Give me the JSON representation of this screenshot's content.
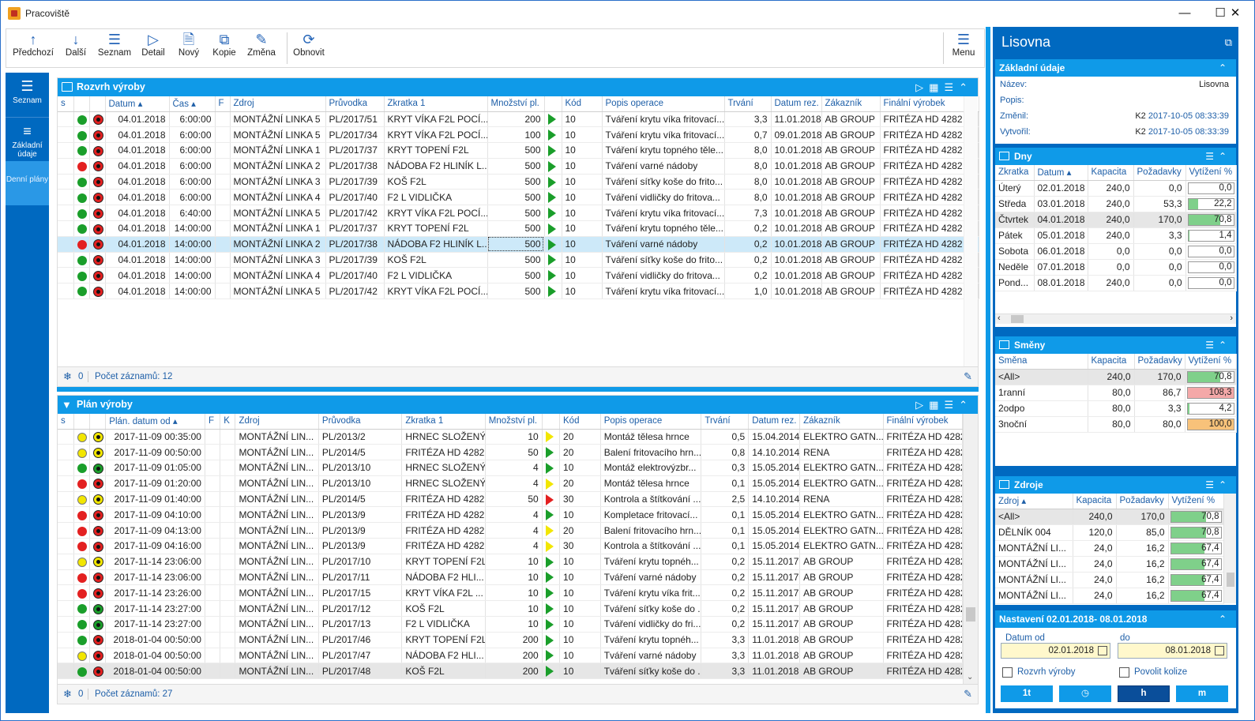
{
  "window": {
    "title": "Pracoviště"
  },
  "toolbar": {
    "prev": "Předchozí",
    "next": "Další",
    "list": "Seznam",
    "detail": "Detail",
    "new": "Nový",
    "copy": "Kopie",
    "change": "Změna",
    "refresh": "Obnovit",
    "menu": "Menu"
  },
  "nav": {
    "list": "Seznam",
    "basic": "Základní údaje",
    "daily": "Denní plány"
  },
  "schedule": {
    "title": "Rozvrh výroby",
    "columns": [
      "s",
      "",
      "",
      "Datum",
      "Čas",
      "F",
      "Zdroj",
      "Průvodka",
      "Zkratka 1",
      "Množství pl.",
      "",
      "Kód",
      "Popis operace",
      "Trvání",
      "Datum rez.",
      "Zákazník",
      "Finální výrobek"
    ],
    "rows": [
      {
        "st": "g",
        "star": "r",
        "date": "04.01.2018",
        "time": "6:00:00",
        "src": "MONTÁŽNÍ LINKA 5",
        "doc": "PL/2017/51",
        "abbr": "KRYT VÍKA F2L POCÍ...",
        "qty": "200",
        "tri": "g",
        "code": "10",
        "op": "Tváření krytu víka fritovací...",
        "dur": "3,3",
        "rez": "11.01.2018",
        "cust": "AB GROUP",
        "prod": "FRITÉZA HD 4282",
        "flag": true
      },
      {
        "st": "g",
        "star": "r",
        "date": "04.01.2018",
        "time": "6:00:00",
        "src": "MONTÁŽNÍ LINKA 5",
        "doc": "PL/2017/34",
        "abbr": "KRYT VÍKA F2L POCÍ...",
        "qty": "100",
        "tri": "g",
        "code": "10",
        "op": "Tváření krytu víka fritovací...",
        "dur": "0,7",
        "rez": "09.01.2018",
        "cust": "AB GROUP",
        "prod": "FRITÉZA HD 4282",
        "flag": true
      },
      {
        "st": "g",
        "star": "r",
        "date": "04.01.2018",
        "time": "6:00:00",
        "src": "MONTÁŽNÍ LINKA 1",
        "doc": "PL/2017/37",
        "abbr": "KRYT TOPENÍ F2L",
        "qty": "500",
        "tri": "g",
        "code": "10",
        "op": "Tváření krytu topného těle...",
        "dur": "8,0",
        "rez": "10.01.2018",
        "cust": "AB GROUP",
        "prod": "FRITÉZA HD 4282",
        "flag": false
      },
      {
        "st": "r",
        "star": "r",
        "date": "04.01.2018",
        "time": "6:00:00",
        "src": "MONTÁŽNÍ LINKA 2",
        "doc": "PL/2017/38",
        "abbr": "NÁDOBA F2 HLINÍK L...",
        "qty": "500",
        "tri": "g",
        "code": "10",
        "op": "Tváření varné nádoby",
        "dur": "8,0",
        "rez": "10.01.2018",
        "cust": "AB GROUP",
        "prod": "FRITÉZA HD 4282",
        "flag": false
      },
      {
        "st": "g",
        "star": "r",
        "date": "04.01.2018",
        "time": "6:00:00",
        "src": "MONTÁŽNÍ LINKA 3",
        "doc": "PL/2017/39",
        "abbr": "KOŠ F2L",
        "qty": "500",
        "tri": "g",
        "code": "10",
        "op": "Tváření síťky koše do frito...",
        "dur": "8,0",
        "rez": "10.01.2018",
        "cust": "AB GROUP",
        "prod": "FRITÉZA HD 4282",
        "flag": false
      },
      {
        "st": "g",
        "star": "r",
        "date": "04.01.2018",
        "time": "6:00:00",
        "src": "MONTÁŽNÍ LINKA 4",
        "doc": "PL/2017/40",
        "abbr": "F2 L VIDLIČKA",
        "qty": "500",
        "tri": "g",
        "code": "10",
        "op": "Tváření vidličky do fritova...",
        "dur": "8,0",
        "rez": "10.01.2018",
        "cust": "AB GROUP",
        "prod": "FRITÉZA HD 4282",
        "flag": false
      },
      {
        "st": "g",
        "star": "r",
        "date": "04.01.2018",
        "time": "6:40:00",
        "src": "MONTÁŽNÍ LINKA 5",
        "doc": "PL/2017/42",
        "abbr": "KRYT VÍKA F2L POCÍ...",
        "qty": "500",
        "tri": "g",
        "code": "10",
        "op": "Tváření krytu víka fritovací...",
        "dur": "7,3",
        "rez": "10.01.2018",
        "cust": "AB GROUP",
        "prod": "FRITÉZA HD 4282",
        "flag": true
      },
      {
        "st": "g",
        "star": "r",
        "date": "04.01.2018",
        "time": "14:00:00",
        "src": "MONTÁŽNÍ LINKA 1",
        "doc": "PL/2017/37",
        "abbr": "KRYT TOPENÍ F2L",
        "qty": "500",
        "tri": "g",
        "code": "10",
        "op": "Tváření krytu topného těle...",
        "dur": "0,2",
        "rez": "10.01.2018",
        "cust": "AB GROUP",
        "prod": "FRITÉZA HD 4282",
        "flag": false
      },
      {
        "st": "r",
        "star": "r",
        "date": "04.01.2018",
        "time": "14:00:00",
        "src": "MONTÁŽNÍ LINKA 2",
        "doc": "PL/2017/38",
        "abbr": "NÁDOBA F2 HLINÍK L...",
        "qty": "500",
        "tri": "g",
        "code": "10",
        "op": "Tváření varné nádoby",
        "dur": "0,2",
        "rez": "10.01.2018",
        "cust": "AB GROUP",
        "prod": "FRITÉZA HD 4282",
        "flag": false,
        "sel": true
      },
      {
        "st": "g",
        "star": "r",
        "date": "04.01.2018",
        "time": "14:00:00",
        "src": "MONTÁŽNÍ LINKA 3",
        "doc": "PL/2017/39",
        "abbr": "KOŠ F2L",
        "qty": "500",
        "tri": "g",
        "code": "10",
        "op": "Tváření síťky koše do frito...",
        "dur": "0,2",
        "rez": "10.01.2018",
        "cust": "AB GROUP",
        "prod": "FRITÉZA HD 4282",
        "flag": false
      },
      {
        "st": "g",
        "star": "r",
        "date": "04.01.2018",
        "time": "14:00:00",
        "src": "MONTÁŽNÍ LINKA 4",
        "doc": "PL/2017/40",
        "abbr": "F2 L VIDLIČKA",
        "qty": "500",
        "tri": "g",
        "code": "10",
        "op": "Tváření vidličky do fritova...",
        "dur": "0,2",
        "rez": "10.01.2018",
        "cust": "AB GROUP",
        "prod": "FRITÉZA HD 4282",
        "flag": false
      },
      {
        "st": "g",
        "star": "r",
        "date": "04.01.2018",
        "time": "14:00:00",
        "src": "MONTÁŽNÍ LINKA 5",
        "doc": "PL/2017/42",
        "abbr": "KRYT VÍKA F2L POCÍ...",
        "qty": "500",
        "tri": "g",
        "code": "10",
        "op": "Tváření krytu víka fritovací...",
        "dur": "1,0",
        "rez": "10.01.2018",
        "cust": "AB GROUP",
        "prod": "FRITÉZA HD 4282",
        "flag": true
      }
    ],
    "footer": {
      "count0": "0",
      "records": "Počet záznamů: 12"
    }
  },
  "plan": {
    "title": "Plán výroby",
    "columns": [
      "s",
      "",
      "",
      "Plán. datum od",
      "F",
      "K",
      "Zdroj",
      "Průvodka",
      "Zkratka 1",
      "Množství pl.",
      "",
      "Kód",
      "Popis operace",
      "Trvání",
      "Datum rez.",
      "Zákazník",
      "Finální výrobek"
    ],
    "rows": [
      {
        "st": "y",
        "star": "y",
        "date": "2017-11-09 00:35:00",
        "src": "MONTÁŽNÍ LIN...",
        "doc": "PL/2013/2",
        "abbr": "HRNEC SLOŽENÝ",
        "qty": "10",
        "tri": "y",
        "code": "20",
        "op": "Montáž tělesa hrnce",
        "dur": "0,5",
        "rez": "15.04.2014",
        "cust": "ELEKTRO GATN...",
        "prod": "FRITÉZA HD 4282"
      },
      {
        "st": "y",
        "star": "y",
        "date": "2017-11-09 00:50:00",
        "src": "MONTÁŽNÍ LIN...",
        "doc": "PL/2014/5",
        "abbr": "FRITÉZA HD 4282",
        "qty": "50",
        "tri": "g",
        "code": "20",
        "op": "Balení fritovacího hrn...",
        "dur": "0,8",
        "rez": "14.10.2014",
        "cust": "RENA",
        "prod": "FRITÉZA HD 4282"
      },
      {
        "st": "g",
        "star": "g",
        "date": "2017-11-09 01:05:00",
        "src": "MONTÁŽNÍ LIN...",
        "doc": "PL/2013/10",
        "abbr": "HRNEC SLOŽENÝ",
        "qty": "4",
        "tri": "g",
        "code": "10",
        "op": "Montáž elektrovýzbr...",
        "dur": "0,3",
        "rez": "15.05.2014",
        "cust": "ELEKTRO GATN...",
        "prod": "FRITÉZA HD 4282"
      },
      {
        "st": "r",
        "star": "r",
        "date": "2017-11-09 01:20:00",
        "src": "MONTÁŽNÍ LIN...",
        "doc": "PL/2013/10",
        "abbr": "HRNEC SLOŽENÝ",
        "qty": "4",
        "tri": "y",
        "code": "20",
        "op": "Montáž tělesa hrnce",
        "dur": "0,1",
        "rez": "15.05.2014",
        "cust": "ELEKTRO GATN...",
        "prod": "FRITÉZA HD 4282"
      },
      {
        "st": "y",
        "star": "y",
        "date": "2017-11-09 01:40:00",
        "src": "MONTÁŽNÍ LIN...",
        "doc": "PL/2014/5",
        "abbr": "FRITÉZA HD 4282",
        "qty": "50",
        "tri": "r",
        "code": "30",
        "op": "Kontrola a štítkování ...",
        "dur": "2,5",
        "rez": "14.10.2014",
        "cust": "RENA",
        "prod": "FRITÉZA HD 4282"
      },
      {
        "st": "r",
        "star": "r",
        "date": "2017-11-09 04:10:00",
        "src": "MONTÁŽNÍ LIN...",
        "doc": "PL/2013/9",
        "abbr": "FRITÉZA HD 4282",
        "qty": "4",
        "tri": "g",
        "code": "10",
        "op": "Kompletace fritovací...",
        "dur": "0,1",
        "rez": "15.05.2014",
        "cust": "ELEKTRO GATN...",
        "prod": "FRITÉZA HD 4282"
      },
      {
        "st": "r",
        "star": "r",
        "date": "2017-11-09 04:13:00",
        "src": "MONTÁŽNÍ LIN...",
        "doc": "PL/2013/9",
        "abbr": "FRITÉZA HD 4282",
        "qty": "4",
        "tri": "y",
        "code": "20",
        "op": "Balení fritovacího hrn...",
        "dur": "0,1",
        "rez": "15.05.2014",
        "cust": "ELEKTRO GATN...",
        "prod": "FRITÉZA HD 4282"
      },
      {
        "st": "r",
        "star": "r",
        "date": "2017-11-09 04:16:00",
        "src": "MONTÁŽNÍ LIN...",
        "doc": "PL/2013/9",
        "abbr": "FRITÉZA HD 4282",
        "qty": "4",
        "tri": "y",
        "code": "30",
        "op": "Kontrola a štítkování ...",
        "dur": "0,1",
        "rez": "15.05.2014",
        "cust": "ELEKTRO GATN...",
        "prod": "FRITÉZA HD 4282"
      },
      {
        "st": "y",
        "star": "y",
        "date": "2017-11-14 23:06:00",
        "src": "MONTÁŽNÍ LIN...",
        "doc": "PL/2017/10",
        "abbr": "KRYT TOPENÍ F2L",
        "qty": "10",
        "tri": "g",
        "code": "10",
        "op": "Tváření krytu topnéh...",
        "dur": "0,2",
        "rez": "15.11.2017",
        "cust": "AB GROUP",
        "prod": "FRITÉZA HD 4282"
      },
      {
        "st": "r",
        "star": "r",
        "date": "2017-11-14 23:06:00",
        "src": "MONTÁŽNÍ LIN...",
        "doc": "PL/2017/11",
        "abbr": "NÁDOBA F2 HLI...",
        "qty": "10",
        "tri": "g",
        "code": "10",
        "op": "Tváření varné nádoby",
        "dur": "0,2",
        "rez": "15.11.2017",
        "cust": "AB GROUP",
        "prod": "FRITÉZA HD 4282"
      },
      {
        "st": "r",
        "star": "r",
        "date": "2017-11-14 23:26:00",
        "src": "MONTÁŽNÍ LIN...",
        "doc": "PL/2017/15",
        "abbr": "KRYT VÍKA F2L ...",
        "qty": "10",
        "tri": "g",
        "code": "10",
        "op": "Tváření krytu víka frit...",
        "dur": "0,2",
        "rez": "15.11.2017",
        "cust": "AB GROUP",
        "prod": "FRITÉZA HD 4282"
      },
      {
        "st": "g",
        "star": "g",
        "date": "2017-11-14 23:27:00",
        "src": "MONTÁŽNÍ LIN...",
        "doc": "PL/2017/12",
        "abbr": "KOŠ F2L",
        "qty": "10",
        "tri": "g",
        "code": "10",
        "op": "Tváření síťky koše do ...",
        "dur": "0,2",
        "rez": "15.11.2017",
        "cust": "AB GROUP",
        "prod": "FRITÉZA HD 4282"
      },
      {
        "st": "g",
        "star": "g",
        "date": "2017-11-14 23:27:00",
        "src": "MONTÁŽNÍ LIN...",
        "doc": "PL/2017/13",
        "abbr": "F2 L VIDLIČKA",
        "qty": "10",
        "tri": "g",
        "code": "10",
        "op": "Tváření vidličky do fri...",
        "dur": "0,2",
        "rez": "15.11.2017",
        "cust": "AB GROUP",
        "prod": "FRITÉZA HD 4282"
      },
      {
        "st": "g",
        "star": "r",
        "date": "2018-01-04 00:50:00",
        "src": "MONTÁŽNÍ LIN...",
        "doc": "PL/2017/46",
        "abbr": "KRYT TOPENÍ F2L",
        "qty": "200",
        "tri": "g",
        "code": "10",
        "op": "Tváření krytu topnéh...",
        "dur": "3,3",
        "rez": "11.01.2018",
        "cust": "AB GROUP",
        "prod": "FRITÉZA HD 4282"
      },
      {
        "st": "y",
        "star": "r",
        "date": "2018-01-04 00:50:00",
        "src": "MONTÁŽNÍ LIN...",
        "doc": "PL/2017/47",
        "abbr": "NÁDOBA F2 HLI...",
        "qty": "200",
        "tri": "g",
        "code": "10",
        "op": "Tváření varné nádoby",
        "dur": "3,3",
        "rez": "11.01.2018",
        "cust": "AB GROUP",
        "prod": "FRITÉZA HD 4282"
      },
      {
        "st": "g",
        "star": "r",
        "date": "2018-01-04 00:50:00",
        "src": "MONTÁŽNÍ LIN...",
        "doc": "PL/2017/48",
        "abbr": "KOŠ F2L",
        "qty": "200",
        "tri": "g",
        "code": "10",
        "op": "Tváření síťky koše do ...",
        "dur": "3,3",
        "rez": "11.01.2018",
        "cust": "AB GROUP",
        "prod": "FRITÉZA HD 4282",
        "gray": true
      }
    ],
    "footer": {
      "count0": "0",
      "records": "Počet záznamů: 27"
    }
  },
  "right": {
    "title": "Lisovna",
    "basic": {
      "title": "Základní údaje",
      "name_k": "Název:",
      "name_v": "Lisovna",
      "desc_k": "Popis:",
      "changed_k": "Změnil:",
      "changed_user": "K2",
      "changed_v": "2017-10-05 08:33:39",
      "created_k": "Vytvořil:",
      "created_user": "K2",
      "created_v": "2017-10-05 08:33:39"
    },
    "days": {
      "title": "Dny",
      "columns": [
        "Zkratka",
        "Datum",
        "Kapacita",
        "Požadavky",
        "Vytížení %"
      ],
      "rows": [
        {
          "a": "Úterý",
          "d": "02.01.2018",
          "k": "240,0",
          "p": "0,0",
          "v": "0,0",
          "pct": 0,
          "c": "#7fd08a"
        },
        {
          "a": "Středa",
          "d": "03.01.2018",
          "k": "240,0",
          "p": "53,3",
          "v": "22,2",
          "pct": 22.2,
          "c": "#7fd08a"
        },
        {
          "a": "Čtvrtek",
          "d": "04.01.2018",
          "k": "240,0",
          "p": "170,0",
          "v": "70,8",
          "pct": 70.8,
          "c": "#7fd08a",
          "gray": true
        },
        {
          "a": "Pátek",
          "d": "05.01.2018",
          "k": "240,0",
          "p": "3,3",
          "v": "1,4",
          "pct": 1.4,
          "c": "#7fd08a"
        },
        {
          "a": "Sobota",
          "d": "06.01.2018",
          "k": "0,0",
          "p": "0,0",
          "v": "0,0",
          "pct": 0,
          "c": "#7fd08a"
        },
        {
          "a": "Neděle",
          "d": "07.01.2018",
          "k": "0,0",
          "p": "0,0",
          "v": "0,0",
          "pct": 0,
          "c": "#7fd08a"
        },
        {
          "a": "Pond...",
          "d": "08.01.2018",
          "k": "240,0",
          "p": "0,0",
          "v": "0,0",
          "pct": 0,
          "c": "#7fd08a"
        }
      ]
    },
    "shifts": {
      "title": "Směny",
      "columns": [
        "Směna",
        "Kapacita",
        "Požadavky",
        "Vytížení %"
      ],
      "rows": [
        {
          "a": "<All>",
          "k": "240,0",
          "p": "170,0",
          "v": "70,8",
          "pct": 70.8,
          "c": "#7fd08a",
          "gray": true
        },
        {
          "a": "1ranní",
          "k": "80,0",
          "p": "86,7",
          "v": "108,3",
          "pct": 100,
          "c": "#f4a8a8"
        },
        {
          "a": "2odpo",
          "k": "80,0",
          "p": "3,3",
          "v": "4,2",
          "pct": 4.2,
          "c": "#7fd08a"
        },
        {
          "a": "3noční",
          "k": "80,0",
          "p": "80,0",
          "v": "100,0",
          "pct": 100,
          "c": "#f8c27a"
        }
      ]
    },
    "sources": {
      "title": "Zdroje",
      "columns": [
        "Zdroj",
        "Kapacita",
        "Požadavky",
        "Vytížení %"
      ],
      "rows": [
        {
          "a": "<All>",
          "k": "240,0",
          "p": "170,0",
          "v": "70,8",
          "pct": 70.8,
          "c": "#7fd08a",
          "gray": true
        },
        {
          "a": "DĚLNÍK 004",
          "k": "120,0",
          "p": "85,0",
          "v": "70,8",
          "pct": 70.8,
          "c": "#7fd08a"
        },
        {
          "a": "MONTÁŽNÍ LI...",
          "k": "24,0",
          "p": "16,2",
          "v": "67,4",
          "pct": 67.4,
          "c": "#7fd08a"
        },
        {
          "a": "MONTÁŽNÍ LI...",
          "k": "24,0",
          "p": "16,2",
          "v": "67,4",
          "pct": 67.4,
          "c": "#7fd08a"
        },
        {
          "a": "MONTÁŽNÍ LI...",
          "k": "24,0",
          "p": "16,2",
          "v": "67,4",
          "pct": 67.4,
          "c": "#7fd08a"
        },
        {
          "a": "MONTÁŽNÍ LI...",
          "k": "24,0",
          "p": "16,2",
          "v": "67,4",
          "pct": 67.4,
          "c": "#7fd08a"
        }
      ]
    },
    "settings": {
      "title": "Nastavení 02.01.2018- 08.01.2018",
      "from_label": "Datum od",
      "to_label": "do",
      "from": "02.01.2018",
      "to": "08.01.2018",
      "chk1": "Rozvrh výroby",
      "chk2": "Povolit kolize",
      "btn1": "1t",
      "btn3": "h",
      "btn4": "m"
    }
  }
}
